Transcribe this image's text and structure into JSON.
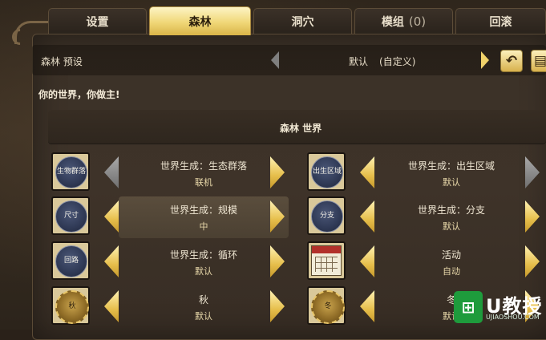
{
  "tabs": [
    {
      "label": "设置",
      "active": false
    },
    {
      "label": "森林",
      "active": true
    },
    {
      "label": "洞穴",
      "active": false
    },
    {
      "label": "模组",
      "count": "(0)",
      "active": false
    },
    {
      "label": "回滚",
      "active": false
    }
  ],
  "preset": {
    "label": "森林 预设",
    "value": "默认",
    "value_sub": "(自定义)"
  },
  "tagline": "你的世界，你做主!",
  "world_title": "森林 世界",
  "settings": [
    {
      "icon_text": "生物群落",
      "title": "世界生成：生态群落",
      "value": "联机"
    },
    {
      "icon_text": "出生区域",
      "title": "世界生成：出生区域",
      "value": "默认"
    },
    {
      "icon_text": "尺寸",
      "title": "世界生成：规模",
      "value": "中"
    },
    {
      "icon_text": "分支",
      "title": "世界生成：分支",
      "value": "默认"
    },
    {
      "icon_text": "回路",
      "title": "世界生成：循环",
      "value": "默认"
    },
    {
      "icon_text": "",
      "title": "活动",
      "value": "自动"
    },
    {
      "icon_text": "秋",
      "title": "秋",
      "value": "默认"
    },
    {
      "icon_text": "冬",
      "title": "冬",
      "value": "默认"
    }
  ],
  "icons": {
    "undo": "undo-icon",
    "extra": "extra-icon",
    "calendar": "calendar-icon"
  },
  "watermark": {
    "brand": "U教授",
    "url": "UJIAOSHOU.COM"
  },
  "colors": {
    "accent": "#f0d26a",
    "panel": "#3b3127"
  }
}
